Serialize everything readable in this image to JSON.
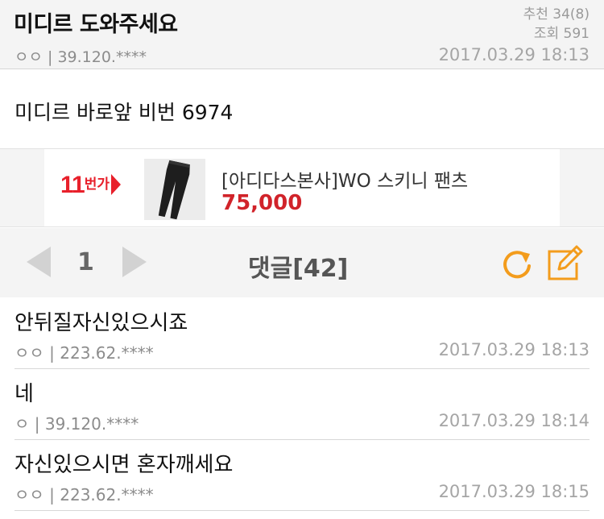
{
  "post": {
    "title": "미디르 도와주세요",
    "recommend": "추천 34(8)",
    "views": "조회 591",
    "author": "ㅇㅇ | 39.120.****",
    "date": "2017.03.29 18:13",
    "body": "미디르 바로앞 비번 6974"
  },
  "ad": {
    "logo_num": "11",
    "logo_word": "번가",
    "product_name": "[아디다스본사]WO 스키니 팬츠",
    "price": "75,000",
    "icon": "pants-image"
  },
  "pager": {
    "page": "1",
    "comments_label": "댓글[42]",
    "prev_icon": "triangle-left-icon",
    "next_icon": "triangle-right-icon",
    "refresh_icon": "refresh-icon",
    "write_icon": "edit-icon",
    "accent": "#f39c1c"
  },
  "comments": [
    {
      "text": "안뒤질자신있으시죠",
      "author": "ㅇㅇ | 223.62.****",
      "date": "2017.03.29 18:13"
    },
    {
      "text": "네",
      "author": "ㅇ | 39.120.****",
      "date": "2017.03.29 18:14"
    },
    {
      "text": "자신있으시면 혼자깨세요",
      "author": "ㅇㅇ | 223.62.****",
      "date": "2017.03.29 18:15"
    }
  ]
}
